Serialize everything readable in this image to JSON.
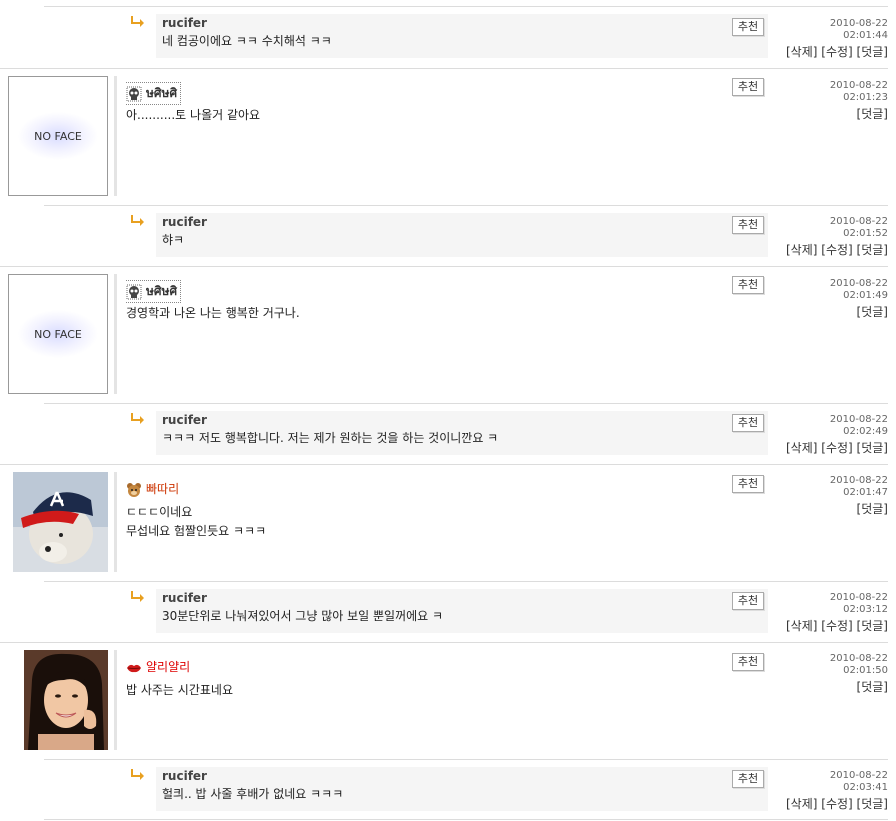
{
  "labels": {
    "recommend": "추천",
    "delete": "[삭제]",
    "edit": "[수정]",
    "reply": "[덧글]",
    "noface": "NO FACE"
  },
  "comments": [
    {
      "type": "reply",
      "author": "rucifer",
      "text": "네 컴공이에요 ㅋㅋ 수치해석 ㅋㅋ",
      "date": "2010-08-22",
      "time": "02:01:44"
    },
    {
      "type": "main",
      "nick": "ษศิษศิ",
      "avatar": "noface",
      "lines": [
        "아..........토 나올거 같아요"
      ],
      "date": "2010-08-22",
      "time": "02:01:23"
    },
    {
      "type": "reply",
      "author": "rucifer",
      "text": "햐ㅋ",
      "date": "2010-08-22",
      "time": "02:01:52"
    },
    {
      "type": "main",
      "nick": "ษศิษศิ",
      "avatar": "noface",
      "lines": [
        "경영학과 나온 나는 행복한 거구나."
      ],
      "date": "2010-08-22",
      "time": "02:01:49"
    },
    {
      "type": "reply",
      "author": "rucifer",
      "text": "ㅋㅋㅋ 저도 행복합니다. 저는 제가 원하는 것을 하는 것이니깐요 ㅋ",
      "date": "2010-08-22",
      "time": "02:02:49"
    },
    {
      "type": "main",
      "nick": "빠따리",
      "avatar": "bear-photo",
      "lines": [
        "ㄷㄷㄷ이네요",
        "무섭네요 험짤인듯요 ㅋㅋㅋ"
      ],
      "date": "2010-08-22",
      "time": "02:01:47"
    },
    {
      "type": "reply",
      "author": "rucifer",
      "text": "30분단위로 나눠져있어서 그냥 많아 보일 뿐일꺼에요 ㅋ",
      "date": "2010-08-22",
      "time": "02:03:12"
    },
    {
      "type": "main",
      "nick": "얄리얄리",
      "avatar": "woman-photo",
      "lines": [
        "밥 사주는 시간표네요"
      ],
      "date": "2010-08-22",
      "time": "02:01:50"
    },
    {
      "type": "reply",
      "author": "rucifer",
      "text": "헐킈.. 밥 사줄 후배가 없네요 ㅋㅋㅋ",
      "date": "2010-08-22",
      "time": "02:03:41"
    }
  ],
  "colors": {
    "reply_bg": "#f5f5f5",
    "nick_bear": "#cc3300",
    "nick_lips": "#dd0000",
    "arrow": "#e8a020"
  }
}
